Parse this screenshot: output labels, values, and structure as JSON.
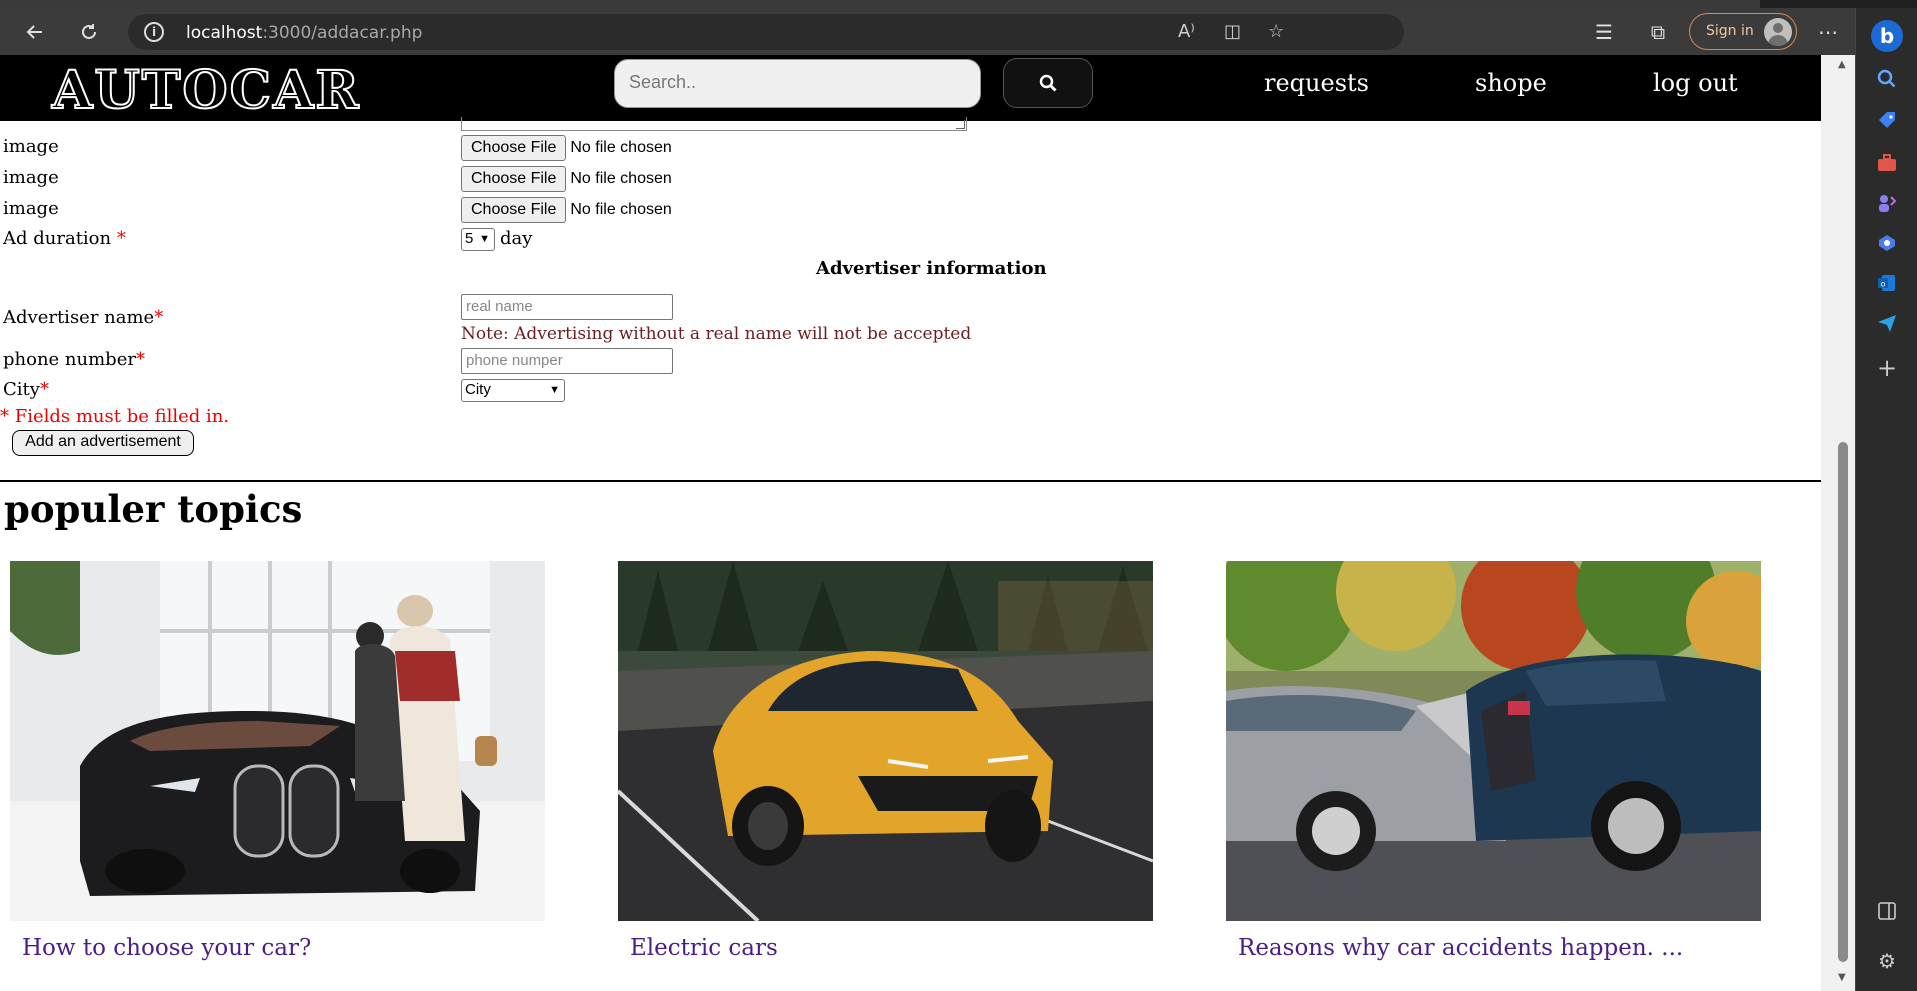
{
  "browser": {
    "url_host": "localhost",
    "url_rest": ":3000/addacar.php",
    "signin_label": "Sign in"
  },
  "site": {
    "logo": "AUTOCAR",
    "search_placeholder": "Search..",
    "nav": [
      "requests",
      "shope",
      "log out"
    ]
  },
  "form": {
    "image_label": "image",
    "file_button": "Choose File",
    "file_status": "No file chosen",
    "ad_duration_label": "Ad duration",
    "ad_duration_value": "5",
    "ad_duration_unit": "day",
    "advertiser_section": "Advertiser information",
    "advertiser_name_label": "Advertiser name",
    "advertiser_name_placeholder": "real name",
    "advertiser_note": "Note: Advertising without a real name will not be accepted",
    "phone_label": "phone number",
    "phone_placeholder": "phone numper",
    "city_label": "City",
    "city_value": "City",
    "required_mark": "*",
    "required_note": "* Fields must be filled in.",
    "submit_label": "Add an advertisement"
  },
  "topics": {
    "heading": "populer topics",
    "cards": [
      {
        "title": "How to choose your car?"
      },
      {
        "title": "Electric cars"
      },
      {
        "title": "Reasons why car accidents happen. ..."
      }
    ]
  }
}
